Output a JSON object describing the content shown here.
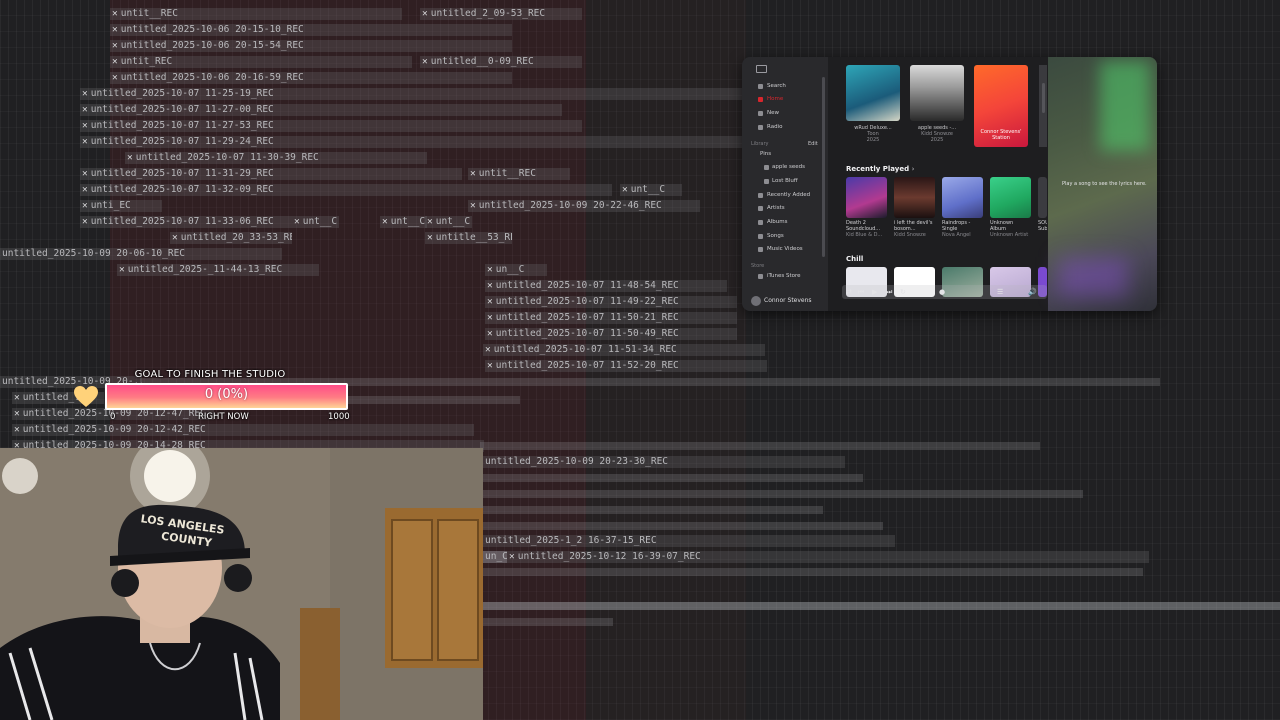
{
  "daw": {
    "clips": [
      {
        "label": "untit__REC"
      },
      {
        "label": "untitled_2025-10-06 20-15-10_REC"
      },
      {
        "label": "untitled_2025-10-06 20-15-54_REC"
      },
      {
        "label": "untit_REC"
      },
      {
        "label": "untitled_2025-10-06 20-16-59_REC"
      },
      {
        "label": "untitled_2025-10-07 11-25-19_REC"
      },
      {
        "label": "untitled_2025-10-07 11-27-00_REC"
      },
      {
        "label": "untitled_2025-10-07 11-27-53_REC"
      },
      {
        "label": "untitled_2025-10-07 11-29-24_REC"
      },
      {
        "label": "untitled_2025-10-07 11-30-39_REC"
      },
      {
        "label": "untitled_2025-10-07 11-31-29_REC"
      },
      {
        "label": "untitled_2025-10-07 11-32-09_REC"
      },
      {
        "label": "unti_EC"
      },
      {
        "label": "untitled_2025-10-07 11-33-06_REC"
      },
      {
        "label": "untitled_20_33-53_REC"
      },
      {
        "label": "untitled_2025-10-09 20-06-10_REC"
      },
      {
        "label": "untitled_2025-_11-44-13_REC"
      },
      {
        "label": "untitled_2_09-53_REC"
      },
      {
        "label": "untitled__0-09_REC"
      },
      {
        "label": "untit__REC"
      },
      {
        "label": "unt__C"
      },
      {
        "label": "untitled_2025-10-09 20-22-46_REC"
      },
      {
        "label": "unt__C"
      },
      {
        "label": "unt__C"
      },
      {
        "label": "unt__C"
      },
      {
        "label": "untitle__53_REC"
      },
      {
        "label": "un__C"
      },
      {
        "label": "untitled_2025-10-07 11-48-54_REC"
      },
      {
        "label": "untitled_2025-10-07 11-49-22_REC"
      },
      {
        "label": "untitled_2025-10-07 11-50-21_REC"
      },
      {
        "label": "untitled_2025-10-07 11-50-49_REC"
      },
      {
        "label": "untitled_2025-10-07 11-51-34_REC"
      },
      {
        "label": "untitled_2025-10-07 11-52-20_REC"
      },
      {
        "label": "untitled_2025-10-09 20-..."
      },
      {
        "label": "untitled_..."
      },
      {
        "label": "untitled_2025-10-09 20-12-47_REC"
      },
      {
        "label": "untitled_2025-10-09 20-12-42_REC"
      },
      {
        "label": "untitled_2025-10-09 20-14-28_REC"
      },
      {
        "label": "untitled_2025-10-09 20-23-30_REC"
      },
      {
        "label": "untitled_2025-1_2 16-37-15_REC"
      },
      {
        "label": "un_C"
      },
      {
        "label": "untitled_2025-10-12 16-39-07_REC"
      }
    ]
  },
  "music": {
    "sidebar": {
      "search": "Search",
      "home": "Home",
      "new": "New",
      "radio": "Radio",
      "library_heading": "Library",
      "edit": "Edit",
      "pins_heading": "Pins",
      "pin1": "apple seeds",
      "pin2": "Lost Bluff",
      "recently_added": "Recently Added",
      "artists": "Artists",
      "albums": "Albums",
      "songs": "Songs",
      "music_videos": "Music Videos",
      "store_heading": "Store",
      "itunes_store": "iTunes Store",
      "user": "Connor Stevens"
    },
    "top_tiles": [
      {
        "title": "wRud Deluxe...",
        "sub1": "Toon",
        "sub2": "2025"
      },
      {
        "title": "apple seeds -...",
        "sub1": "Kidd Snowze",
        "sub2": "2025"
      },
      {
        "title": "Connor Stevens'",
        "sub1": "Station",
        "sub2": ""
      }
    ],
    "recently_played_heading": "Recently Played",
    "recently_played": [
      {
        "title": "Death 2",
        "title2": "Soundcloud...",
        "sub": "Kid Blue & D..."
      },
      {
        "title": "i left the devil's",
        "title2": "bosom...",
        "sub": "Kidd Snowze"
      },
      {
        "title": "Raindrops -",
        "title2": "Single",
        "sub": "Nova Angel"
      },
      {
        "title": "Unknown",
        "title2": "Album",
        "sub": "Unknown Artist"
      },
      {
        "title": "SOU",
        "title2": "Sub",
        "sub": ""
      }
    ],
    "chill_heading": "Chill",
    "lyrics_hint": "Play a song to see the lyrics here.",
    "colors": {
      "accent_red": "#d8262d"
    }
  },
  "goal": {
    "title": "GOAL TO FINISH THE STUDIO",
    "value_text": "0 (0%)",
    "progress_fraction": 0,
    "min_label": "0",
    "center_label": "RIGHT NOW",
    "max_label": "1000",
    "icon": "heart-icon",
    "colors": {
      "fill_top": "#ff4d88",
      "fill_bottom": "#ffd596",
      "heart": "#ffd27a"
    }
  },
  "webcam": {
    "cap_text_line1": "LOS ANGELES",
    "cap_text_line2": "COUNTY"
  }
}
